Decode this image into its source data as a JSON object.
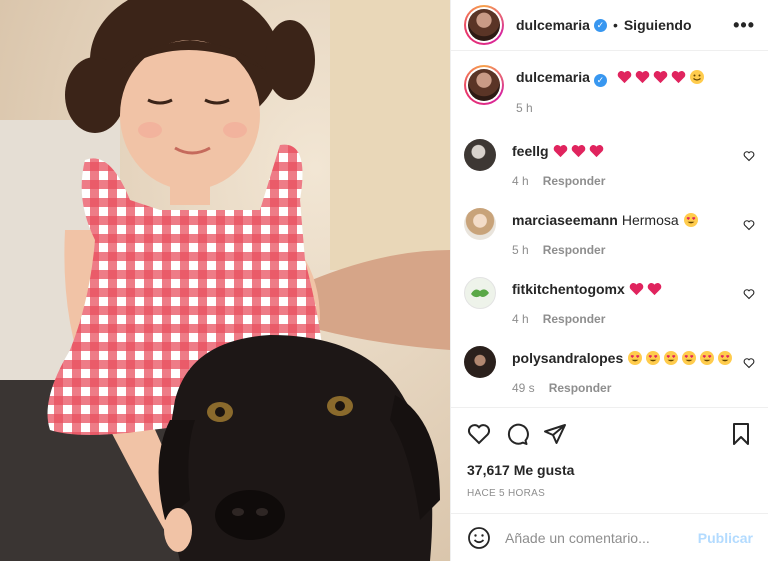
{
  "post": {
    "username": "dulcemaria",
    "follow_label": "Siguiendo",
    "more_label": "•••"
  },
  "caption": {
    "username": "dulcemaria",
    "time": "5 h"
  },
  "comments": [
    {
      "username": "feellg",
      "text": "",
      "time": "4 h",
      "reply": "Responder"
    },
    {
      "username": "marciaseemann",
      "text": "Hermosa",
      "time": "5 h",
      "reply": "Responder"
    },
    {
      "username": "fitkitchentogomx",
      "text": "",
      "time": "4 h",
      "reply": "Responder"
    },
    {
      "username": "polysandralopes",
      "text": "",
      "time": "49 s",
      "reply": "Responder"
    }
  ],
  "likes": "37,617 Me gusta",
  "posted_ago": "HACE 5 HORAS",
  "add_comment": {
    "placeholder": "Añade un comentario...",
    "post_label": "Publicar"
  },
  "colors": {
    "accent_blue": "#3897f0",
    "publish_disabled": "#b3dbff",
    "heart_red": "#e0245e",
    "muted": "#8e8e8e"
  },
  "icons": [
    "heart-icon",
    "comment-icon",
    "share-icon",
    "bookmark-icon",
    "smile-icon",
    "verified-icon",
    "more-icon"
  ]
}
